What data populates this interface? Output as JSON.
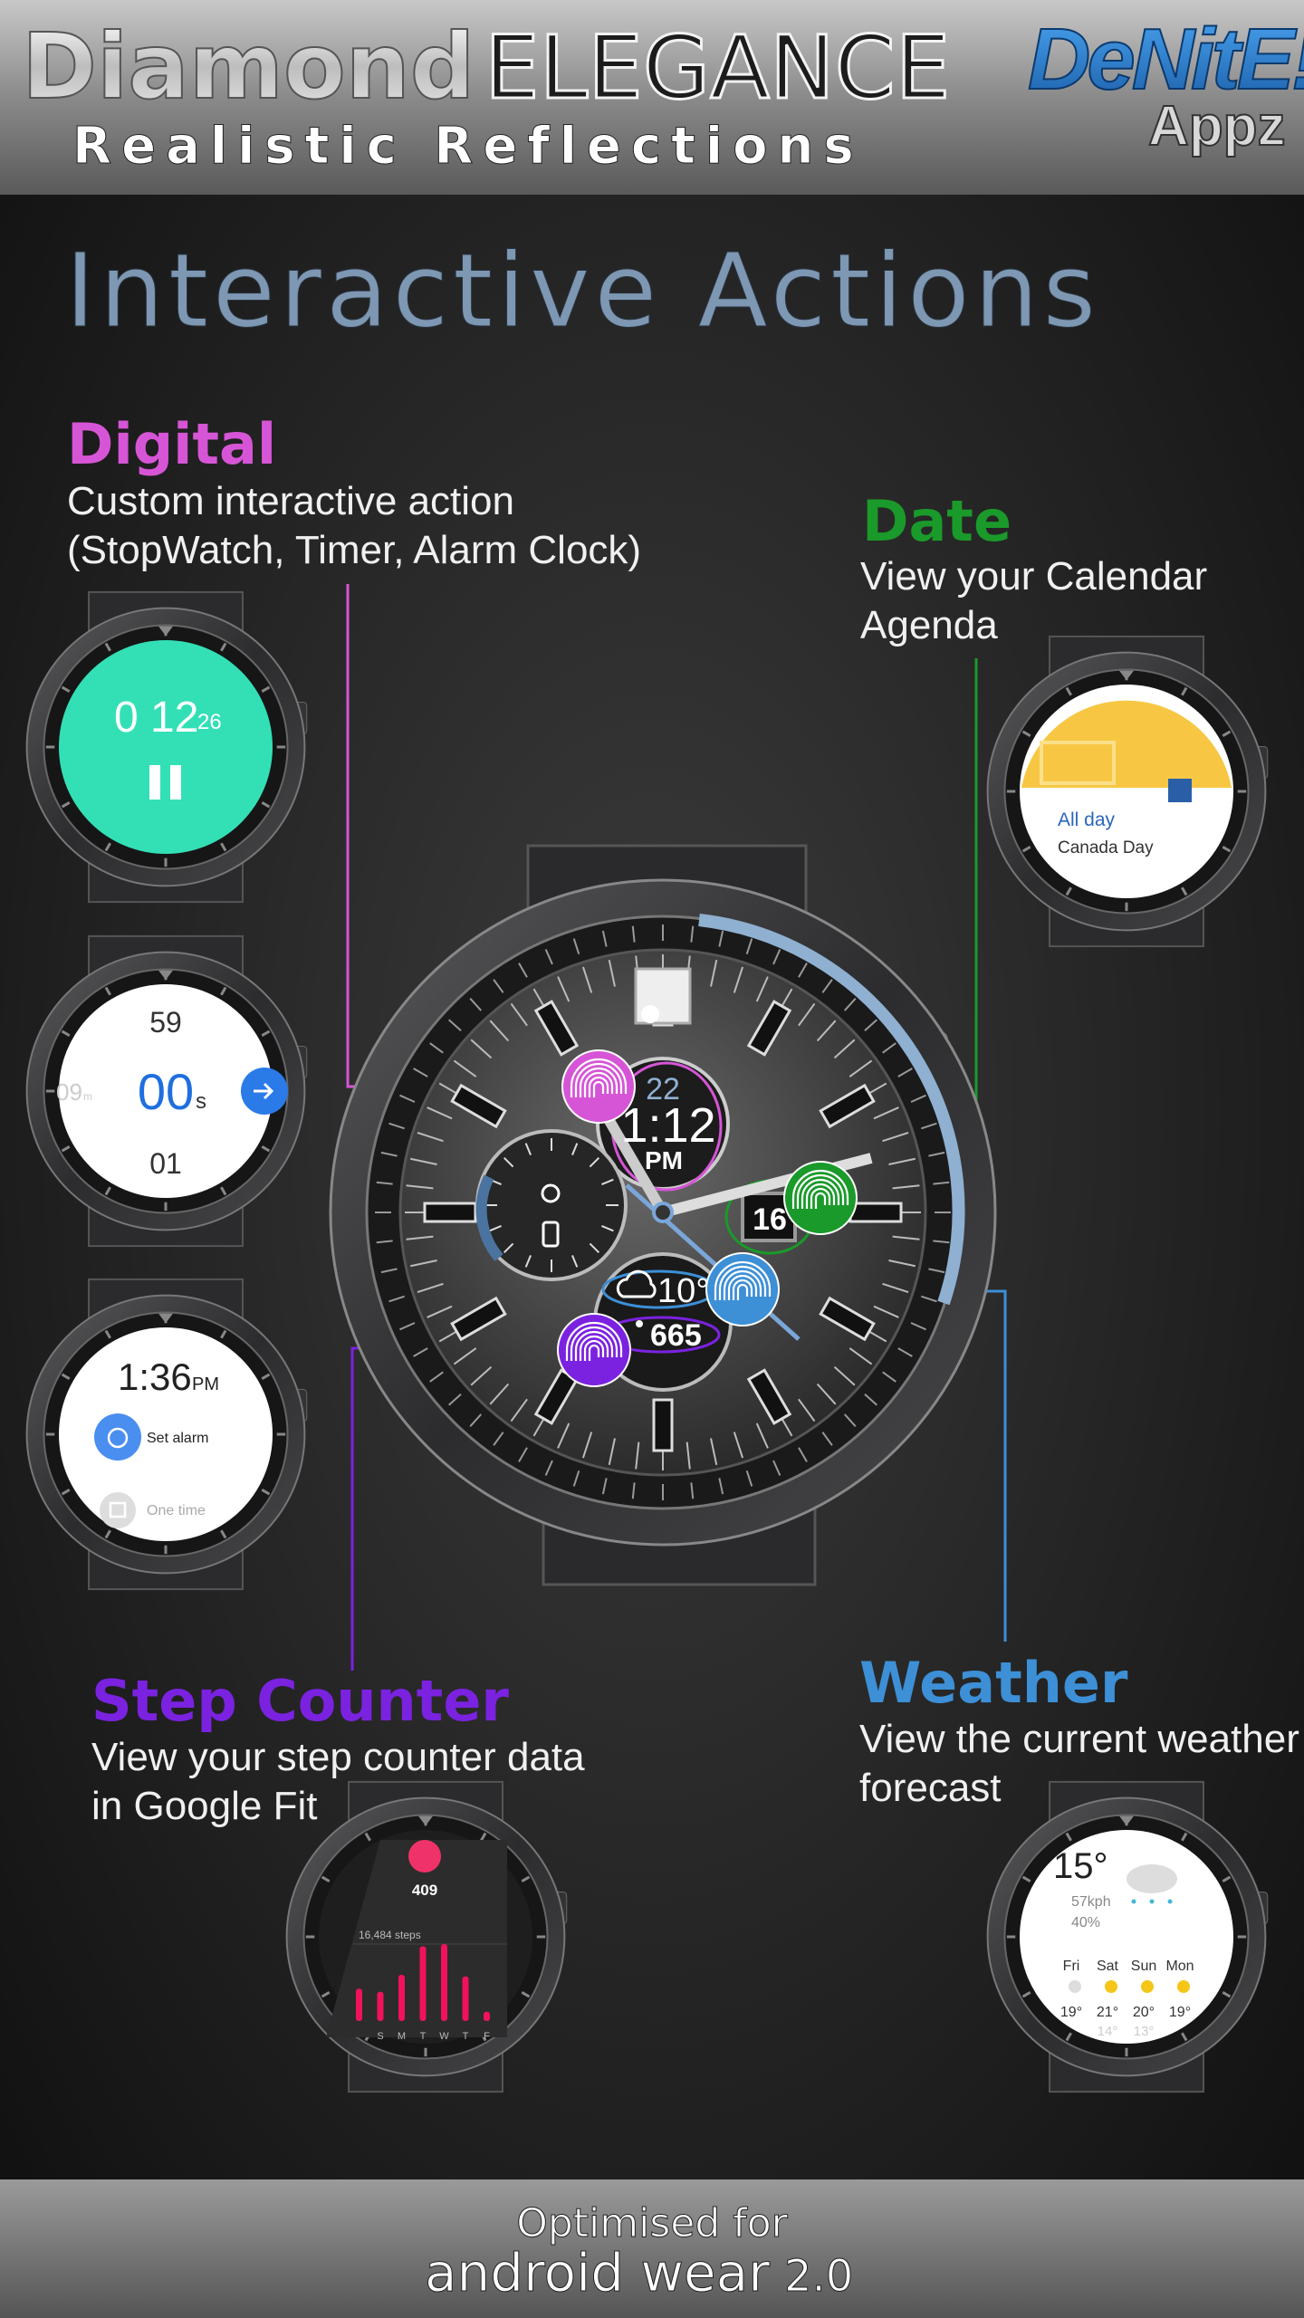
{
  "header": {
    "title_part1": "Diamond",
    "title_part2": "ELEGANCE",
    "subtitle": "Realistic Reflections",
    "logo_main": "DeNitE!",
    "logo_sub": "Appz"
  },
  "page_title": "Interactive Actions",
  "colors": {
    "digital": "#d655d6",
    "date": "#1a9a2a",
    "step": "#7b22e0",
    "weather": "#3d8fd6",
    "title": "#7e97b3"
  },
  "features": {
    "digital": {
      "title": "Digital",
      "line1": "Custom interactive action",
      "line2": "(StopWatch, Timer, Alarm Clock)"
    },
    "date": {
      "title": "Date",
      "line1": "View your Calendar",
      "line2": "Agenda"
    },
    "step": {
      "title": "Step Counter",
      "line1": "View your step counter data",
      "line2": "in Google Fit"
    },
    "weather": {
      "title": "Weather",
      "line1": "View the current weather",
      "line2": "forecast"
    }
  },
  "main_watch": {
    "date_top": "22",
    "time": "1:12",
    "ampm": "PM",
    "day": "16",
    "temperature": "10°",
    "steps": "665",
    "icons": [
      "fingerprint-icon",
      "watch-icon",
      "phone-icon",
      "rain-cloud-icon",
      "walking-icon",
      "diamond-icon"
    ]
  },
  "stopwatch": {
    "minutes": "0 12",
    "seconds": "26",
    "icon": "pause-icon"
  },
  "timer": {
    "above": "59",
    "value": "00",
    "unit": "s",
    "below": "01",
    "left_value": "09",
    "left_unit": "m",
    "icon": "arrow-right-icon"
  },
  "alarm": {
    "time": "1:36",
    "ampm": "PM",
    "action": "Set alarm",
    "repeat": "One time"
  },
  "calendar": {
    "label": "All day",
    "event": "Canada Day"
  },
  "fit": {
    "current": "409",
    "total": "16,484 steps",
    "days": [
      "S",
      "M",
      "T",
      "W",
      "T",
      "F"
    ],
    "day_levels": [
      0.42,
      0.38,
      0.6,
      0.97,
      1.0,
      0.58,
      0.12
    ]
  },
  "weather_watch": {
    "temp": "15°",
    "wind": "57kph",
    "precip": "40%",
    "forecast": [
      {
        "day": "Fri",
        "high": "19°",
        "low": ""
      },
      {
        "day": "Sat",
        "high": "21°",
        "low": "14°"
      },
      {
        "day": "Sun",
        "high": "20°",
        "low": "13°"
      },
      {
        "day": "Mon",
        "high": "19°",
        "low": ""
      }
    ]
  },
  "footer": {
    "line1": "Optimised for",
    "line2": "android wear",
    "version": "2.0"
  }
}
